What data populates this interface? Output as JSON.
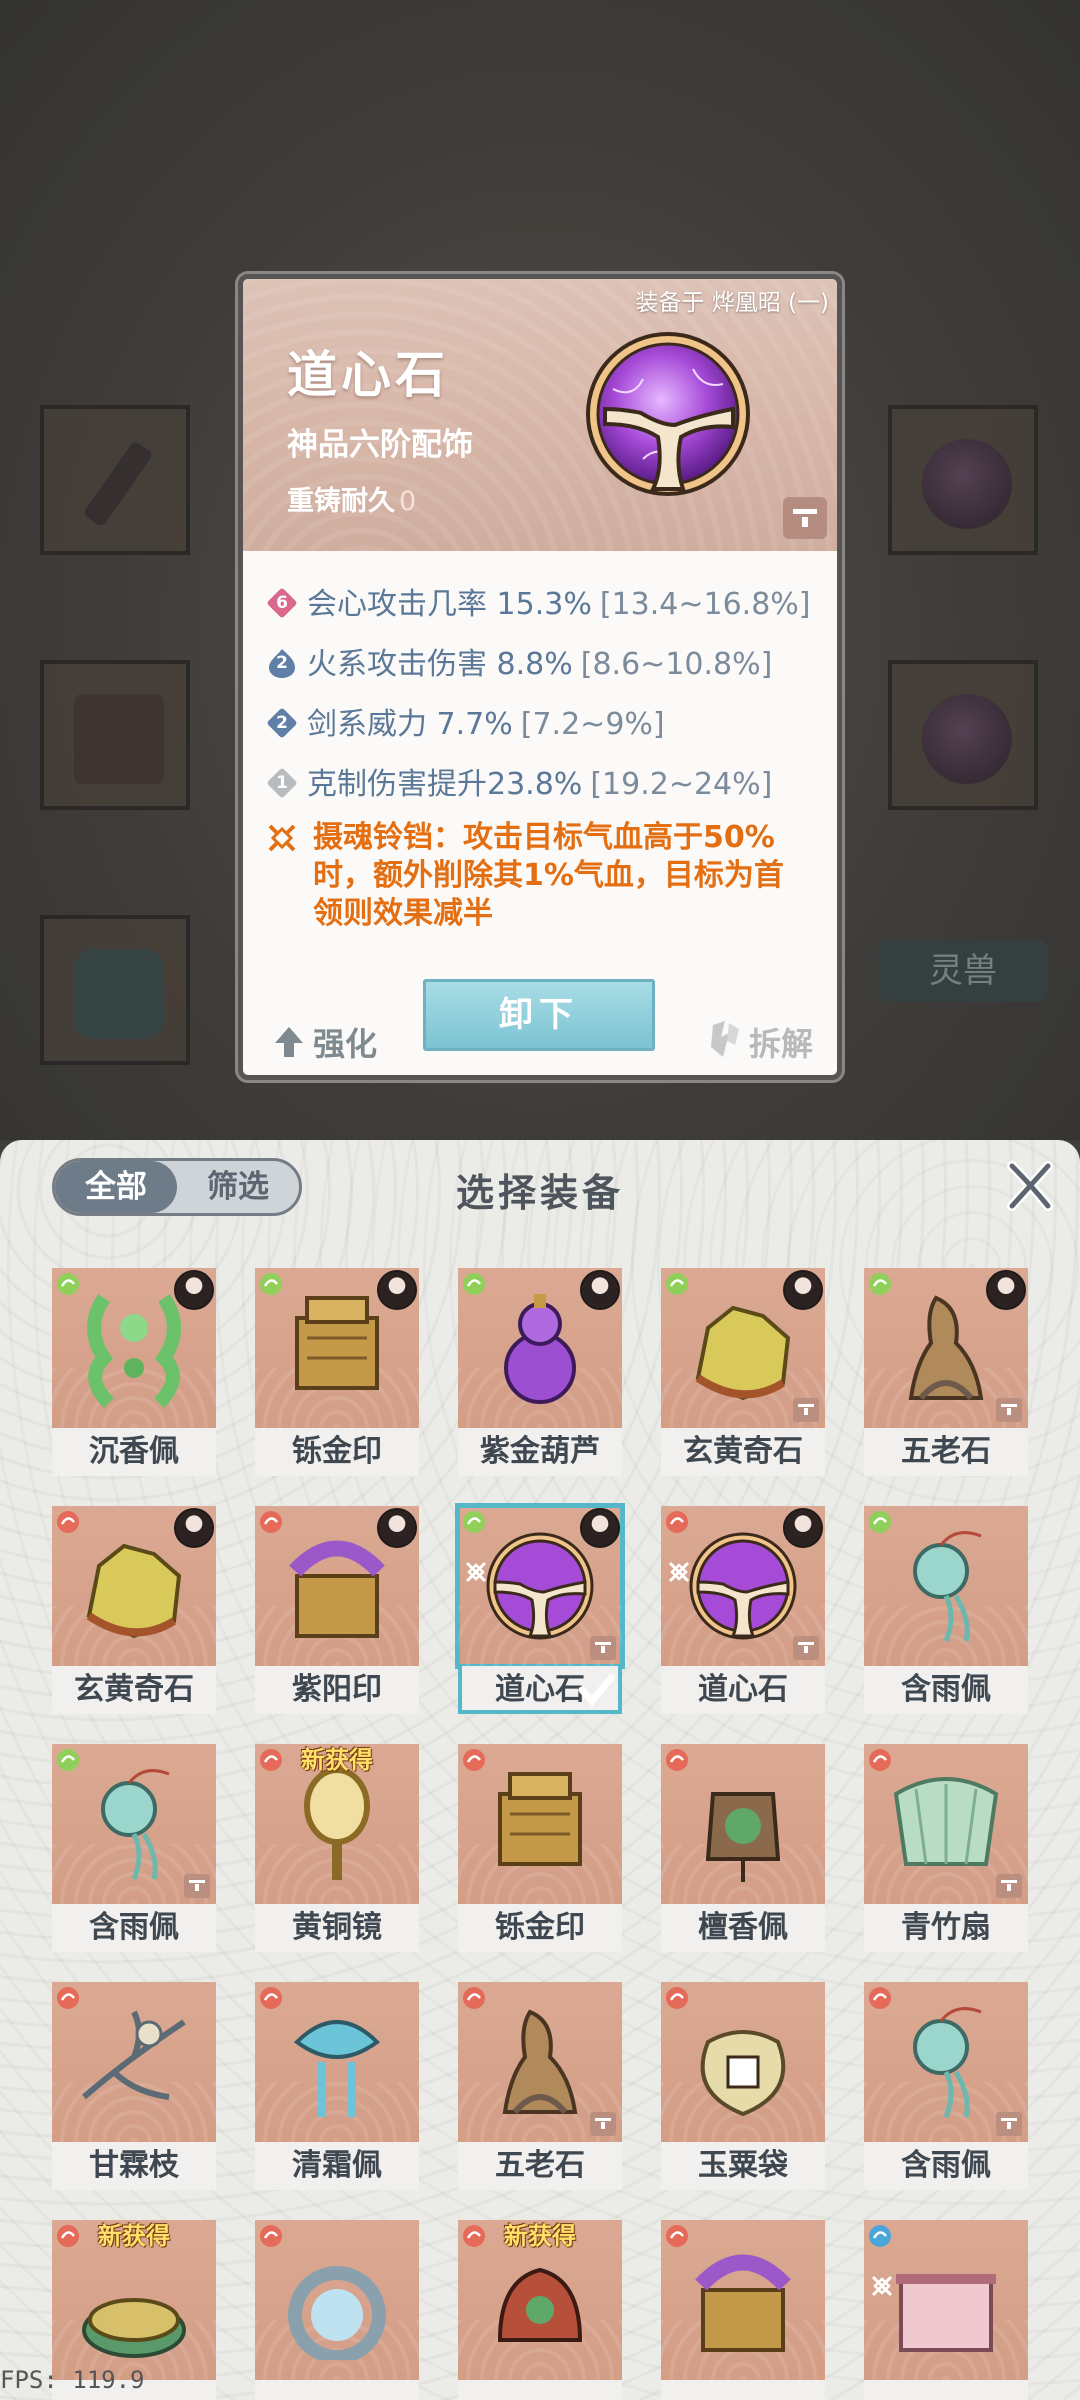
{
  "background": {
    "lingshou_label": "灵兽"
  },
  "popup": {
    "equipped_on": "装备于 烨凰昭 (一)",
    "name": "道心石",
    "grade": "神品六阶配饰",
    "recast_label": "重铸耐久",
    "recast_value": "0",
    "stats": [
      {
        "badge": "6",
        "text": "会心攻击几率 15.3%",
        "range": "[13.4~16.8%]",
        "badge_color": "#d9688c"
      },
      {
        "badge": "2",
        "text": "火系攻击伤害 8.8%",
        "range": "[8.6~10.8%]",
        "badge_color": "#5f7fa6"
      },
      {
        "badge": "2",
        "text": "剑系威力 7.7%",
        "range": "[7.2~9%]",
        "badge_color": "#5f7fa6"
      },
      {
        "badge": "1",
        "text": "克制伤害提升23.8%",
        "range": "[19.2~24%]",
        "badge_color": "#b9bcbf"
      }
    ],
    "set_effect": "摄魂铃铛：攻击目标气血高于50%时，额外削除其1%气血，目标为首领则效果减半",
    "btn_enhance": "强化",
    "btn_unequip": "卸下",
    "btn_dismantle": "拆解"
  },
  "panel": {
    "tab_all": "全部",
    "tab_filter": "筛选",
    "title": "选择装备",
    "items": [
      {
        "name": "沉香佩",
        "badge": "green",
        "art": "jade",
        "avatar": true,
        "corner": false,
        "new": false,
        "selected": false,
        "set": false
      },
      {
        "name": "铄金印",
        "badge": "green",
        "art": "seal",
        "avatar": true,
        "corner": false,
        "new": false,
        "selected": false,
        "set": false
      },
      {
        "name": "紫金葫芦",
        "badge": "green",
        "art": "gourd",
        "avatar": true,
        "corner": false,
        "new": false,
        "selected": false,
        "set": false
      },
      {
        "name": "玄黄奇石",
        "badge": "green",
        "art": "gold-rock",
        "avatar": true,
        "corner": true,
        "new": false,
        "selected": false,
        "set": false
      },
      {
        "name": "五老石",
        "badge": "green",
        "art": "stone",
        "avatar": true,
        "corner": true,
        "new": false,
        "selected": false,
        "set": false
      },
      {
        "name": "玄黄奇石",
        "badge": "red",
        "art": "gold-rock",
        "avatar": true,
        "corner": false,
        "new": false,
        "selected": false,
        "set": false
      },
      {
        "name": "紫阳印",
        "badge": "red",
        "art": "purple-seal",
        "avatar": true,
        "corner": false,
        "new": false,
        "selected": false,
        "set": false
      },
      {
        "name": "道心石",
        "badge": "green",
        "art": "orb",
        "avatar": true,
        "corner": true,
        "new": false,
        "selected": true,
        "set": true
      },
      {
        "name": "道心石",
        "badge": "red",
        "art": "orb",
        "avatar": true,
        "corner": true,
        "new": false,
        "selected": false,
        "set": true
      },
      {
        "name": "含雨佩",
        "badge": "green",
        "art": "pendant",
        "avatar": false,
        "corner": false,
        "new": false,
        "selected": false,
        "set": false
      },
      {
        "name": "含雨佩",
        "badge": "green",
        "art": "pendant",
        "avatar": false,
        "corner": true,
        "new": false,
        "selected": false,
        "set": false
      },
      {
        "name": "黄铜镜",
        "badge": "red",
        "art": "mirror",
        "avatar": false,
        "corner": false,
        "new": true,
        "selected": false,
        "set": false
      },
      {
        "name": "铄金印",
        "badge": "red",
        "art": "seal",
        "avatar": false,
        "corner": false,
        "new": false,
        "selected": false,
        "set": false
      },
      {
        "name": "檀香佩",
        "badge": "red",
        "art": "amulet",
        "avatar": false,
        "corner": false,
        "new": false,
        "selected": false,
        "set": false
      },
      {
        "name": "青竹扇",
        "badge": "red",
        "art": "fan",
        "avatar": false,
        "corner": true,
        "new": false,
        "selected": false,
        "set": false
      },
      {
        "name": "甘霖枝",
        "badge": "red",
        "art": "branch",
        "avatar": false,
        "corner": false,
        "new": false,
        "selected": false,
        "set": false
      },
      {
        "name": "清霜佩",
        "badge": "red",
        "art": "frost",
        "avatar": false,
        "corner": false,
        "new": false,
        "selected": false,
        "set": false
      },
      {
        "name": "五老石",
        "badge": "red",
        "art": "stone",
        "avatar": false,
        "corner": true,
        "new": false,
        "selected": false,
        "set": false
      },
      {
        "name": "玉粟袋",
        "badge": "red",
        "art": "bag",
        "avatar": false,
        "corner": false,
        "new": false,
        "selected": false,
        "set": false
      },
      {
        "name": "含雨佩",
        "badge": "red",
        "art": "pendant",
        "avatar": false,
        "corner": true,
        "new": false,
        "selected": false,
        "set": false
      },
      {
        "name": "",
        "badge": "red",
        "art": "drum",
        "avatar": false,
        "corner": false,
        "new": true,
        "selected": false,
        "set": false
      },
      {
        "name": "",
        "badge": "red",
        "art": "ring",
        "avatar": false,
        "corner": false,
        "new": false,
        "selected": false,
        "set": false
      },
      {
        "name": "",
        "badge": "red",
        "art": "mask",
        "avatar": false,
        "corner": false,
        "new": true,
        "selected": false,
        "set": false
      },
      {
        "name": "",
        "badge": "red",
        "art": "purple-seal",
        "avatar": false,
        "corner": false,
        "new": false,
        "selected": false,
        "set": false
      },
      {
        "name": "",
        "badge": "blue",
        "art": "scroll",
        "avatar": false,
        "corner": false,
        "new": false,
        "selected": false,
        "set": true
      }
    ],
    "new_tag": "新获得"
  },
  "fps": "FPS: 119.9",
  "colors": {
    "accent": "#54b8c8",
    "badge_green": "#8fcf5a",
    "badge_red": "#e56a5a",
    "badge_blue": "#4aa5d8",
    "set_effect": "#e46f13",
    "stat_text": "#5b7898"
  }
}
